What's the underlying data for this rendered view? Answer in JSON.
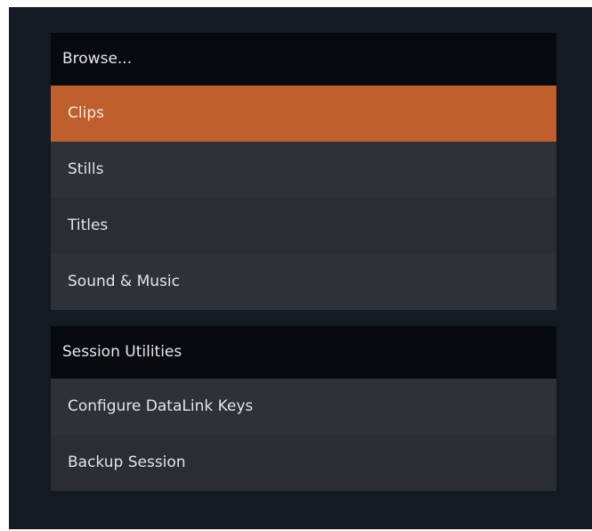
{
  "browse": {
    "header": "Browse...",
    "items": [
      {
        "label": "Clips",
        "selected": true
      },
      {
        "label": "Stills",
        "selected": false
      },
      {
        "label": "Titles",
        "selected": false
      },
      {
        "label": "Sound & Music",
        "selected": false
      }
    ]
  },
  "session": {
    "header": "Session Utilities",
    "items": [
      {
        "label": "Configure DataLink Keys"
      },
      {
        "label": "Backup Session"
      }
    ]
  },
  "colors": {
    "background": "#131a21",
    "header_bg": "#060a0e",
    "item_bg": "#2e3135",
    "selected_bg": "#bf5f2e",
    "text": "#e2e4e6"
  }
}
